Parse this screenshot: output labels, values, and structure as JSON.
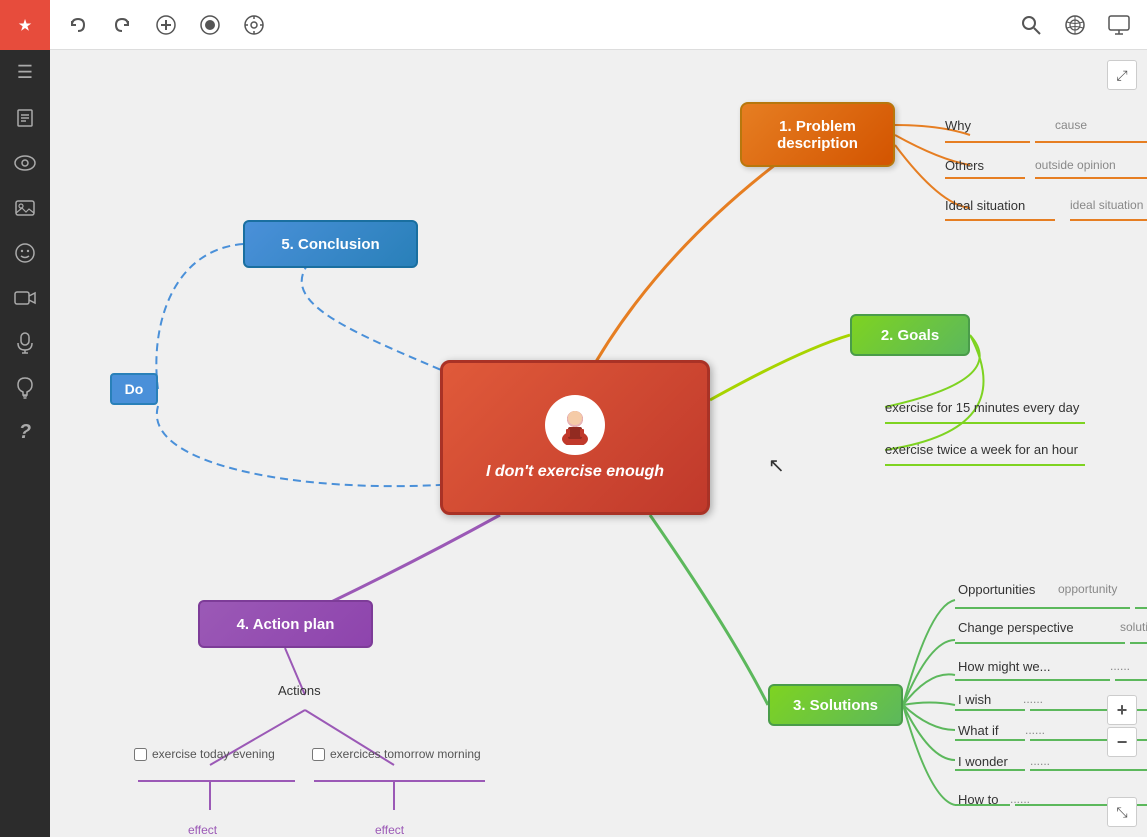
{
  "sidebar": {
    "logo_icon": "★",
    "items": [
      {
        "name": "hamburger-menu",
        "icon": "☰",
        "label": "Menu"
      },
      {
        "name": "notes-icon",
        "icon": "📄",
        "label": "Notes"
      },
      {
        "name": "glasses-icon",
        "icon": "👓",
        "label": "View"
      },
      {
        "name": "image-icon",
        "icon": "🖼",
        "label": "Image"
      },
      {
        "name": "emoji-icon",
        "icon": "😊",
        "label": "Emoji"
      },
      {
        "name": "video-icon",
        "icon": "🎬",
        "label": "Video"
      },
      {
        "name": "mic-icon",
        "icon": "🎤",
        "label": "Mic"
      },
      {
        "name": "bulb-icon",
        "icon": "💡",
        "label": "Idea"
      },
      {
        "name": "help-icon",
        "icon": "?",
        "label": "Help"
      }
    ]
  },
  "toolbar": {
    "undo_label": "↩",
    "redo_label": "↪",
    "add_label": "+",
    "record_label": "⏺",
    "settings_label": "⚙",
    "search_label": "🔍",
    "share_label": "⊕",
    "present_label": "🖥"
  },
  "nodes": {
    "central": {
      "text": "I don't exercise enough"
    },
    "problem": {
      "text": "1. Problem\ndescription"
    },
    "goals": {
      "text": "2. Goals"
    },
    "solutions": {
      "text": "3. Solutions"
    },
    "action_plan": {
      "text": "4. Action plan"
    },
    "conclusion": {
      "text": "5. Conclusion"
    },
    "do": {
      "text": "Do"
    }
  },
  "problem_branches": {
    "why": "Why",
    "why_sub": "cause",
    "others": "Others",
    "others_sub": "outside opinion",
    "ideal": "Ideal situation",
    "ideal_sub": "ideal situation"
  },
  "goals_branches": {
    "item1": "exercise for 15 minutes every day",
    "item2": "exercise twice a week for an hour"
  },
  "solutions_branches": {
    "opportunities": "Opportunities",
    "opportunities_sub": "opportunity",
    "change": "Change perspective",
    "change_sub": "solution",
    "how_might": "How might we...",
    "how_might_sub": "......",
    "i_wish": "I wish",
    "i_wish_sub": "......",
    "what_if": "What if",
    "what_if_sub": "......",
    "i_wonder": "I wonder",
    "i_wonder_sub": "......",
    "how_to": "How to",
    "how_to_sub": "......"
  },
  "action_branches": {
    "actions_label": "Actions",
    "item1_text": "exercise today evening",
    "item2_text": "exercices tomorrow morning",
    "effect1": "effect",
    "effect2": "effect"
  }
}
